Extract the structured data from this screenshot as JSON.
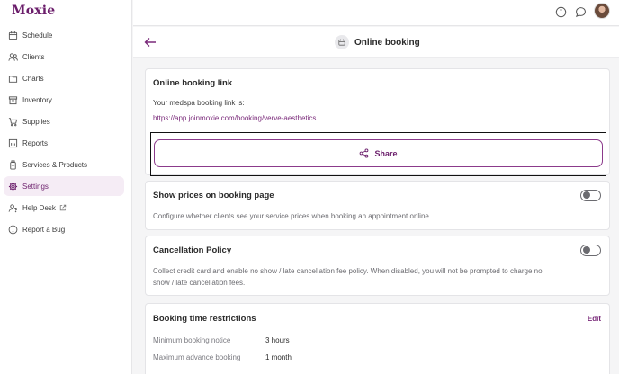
{
  "app": {
    "logo": "Moxie"
  },
  "sidebar": {
    "items": [
      {
        "label": "Schedule",
        "icon": "calendar-icon",
        "active": false
      },
      {
        "label": "Clients",
        "icon": "users-icon",
        "active": false
      },
      {
        "label": "Charts",
        "icon": "folder-icon",
        "active": false
      },
      {
        "label": "Inventory",
        "icon": "archive-icon",
        "active": false
      },
      {
        "label": "Supplies",
        "icon": "cart-icon",
        "active": false
      },
      {
        "label": "Reports",
        "icon": "bar-chart-icon",
        "active": false
      },
      {
        "label": "Services & Products",
        "icon": "bottle-icon",
        "active": false
      },
      {
        "label": "Settings",
        "icon": "gear-icon",
        "active": true
      },
      {
        "label": "Help Desk",
        "icon": "help-user-icon",
        "active": false
      },
      {
        "label": "Report a Bug",
        "icon": "alert-icon",
        "active": false
      }
    ]
  },
  "topbar": {
    "icons": [
      "info-icon",
      "chat-icon",
      "avatar"
    ]
  },
  "header": {
    "title": "Online booking",
    "title_icon": "calendar-icon"
  },
  "booking_link_card": {
    "title": "Online booking link",
    "intro": "Your medspa booking link is:",
    "url": "https://app.joinmoxie.com/booking/verve-aesthetics",
    "share_label": "Share"
  },
  "show_prices_card": {
    "title": "Show prices on booking page",
    "description": "Configure whether clients see your service prices when booking an appointment online.",
    "enabled": false
  },
  "cancellation_card": {
    "title": "Cancellation Policy",
    "description_line1": "Collect credit card and enable no show / late cancellation fee policy. When disabled, you will not be prompted to charge no",
    "description_line2": "show / late cancellation fees.",
    "enabled": false
  },
  "time_restrictions_card": {
    "title": "Booking time restrictions",
    "edit_label": "Edit",
    "rows": [
      {
        "label": "Minimum booking notice",
        "value": "3 hours"
      },
      {
        "label": "Maximum advance booking",
        "value": "1 month"
      }
    ]
  },
  "colors": {
    "brand": "#6b1e6b",
    "active_bg": "#f5ecf5",
    "link": "#7a2a7a"
  }
}
